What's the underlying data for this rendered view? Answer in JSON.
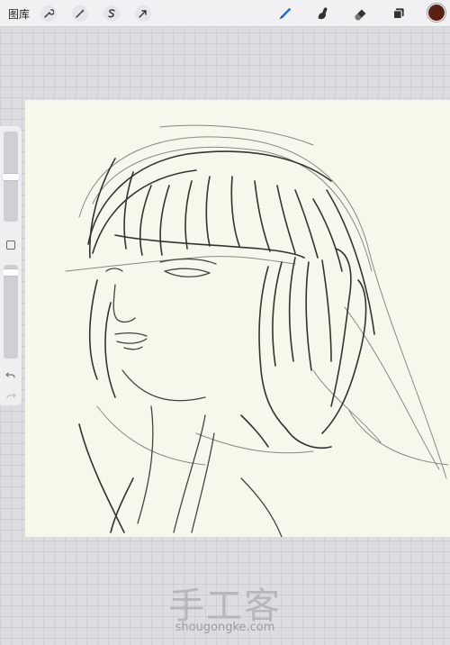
{
  "toolbar": {
    "gallery_label": "图库",
    "left_tools": [
      "wrench-icon",
      "magic-wand-icon",
      "selection-icon",
      "transform-arrow-icon"
    ],
    "right_tools": [
      "brush-icon",
      "smudge-icon",
      "eraser-icon",
      "layers-icon"
    ],
    "active_tool": "brush",
    "accent_color": "#1f6fd6",
    "current_color": "#5a2112"
  },
  "sidebar": {
    "brush_size_level": 0.5,
    "opacity_level": 0.05,
    "undo_icon": "undo-icon",
    "redo_icon": "redo-icon"
  },
  "canvas": {
    "background_color": "#f6f8ec",
    "content": "pencil sketch of a girl with bangs resting her face on her hands"
  },
  "watermark": {
    "title": "手工客",
    "url": "shougongke.com"
  }
}
